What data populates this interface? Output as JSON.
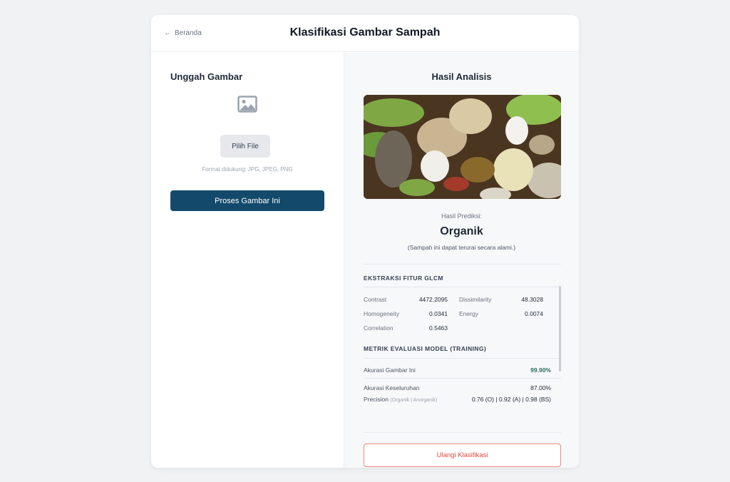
{
  "header": {
    "back_label": "Beranda",
    "title": "Klasifikasi Gambar Sampah"
  },
  "upload": {
    "section_title": "Unggah Gambar",
    "pick_file_label": "Pilih File",
    "format_hint": "Format didukung: JPG, JPEG, PNG",
    "process_button_label": "Proses Gambar Ini",
    "image_icon": "image-placeholder-icon"
  },
  "result": {
    "section_title": "Hasil Analisis",
    "prediction_label": "Hasil Prediksi:",
    "prediction_value": "Organik",
    "prediction_desc": "(Sampah ini dapat terurai secara alami.)",
    "glcm": {
      "title": "EKSTRAKSI FITUR GLCM",
      "features": [
        {
          "name": "Contrast",
          "value": "4472.2095"
        },
        {
          "name": "Dissimilarity",
          "value": "48.3028"
        },
        {
          "name": "Homogeneity",
          "value": "0.0341"
        },
        {
          "name": "Energy",
          "value": "0.0074"
        },
        {
          "name": "Correlation",
          "value": "0.5463"
        }
      ]
    },
    "metrics": {
      "title": "METRIK EVALUASI MODEL (TRAINING)",
      "image_accuracy_label": "Akurasi Gambar Ini",
      "image_accuracy_value": "99.90%",
      "overall_accuracy_label": "Akurasi Keseluruhan",
      "overall_accuracy_value": "87.00%",
      "precision_label": "Precision",
      "precision_sub": "(Organik | Anorganik)",
      "precision_value": "0.76 (O) | 0.92 (A) | 0.98 (BS)"
    },
    "retry_label": "Ulangi Klasifikasi"
  },
  "colors": {
    "primary": "#134a6b",
    "accent_green": "#2f6b5a",
    "danger": "#e0483d",
    "background": "#f1f2f4"
  }
}
